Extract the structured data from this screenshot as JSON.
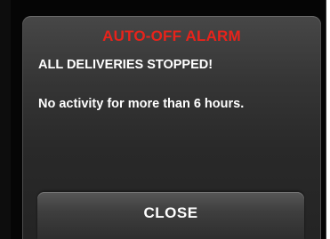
{
  "alarm": {
    "title": "AUTO-OFF ALARM",
    "line1": "ALL DELIVERIES STOPPED!",
    "line2": "No activity for more than 6 hours.",
    "title_color": "#e8231b"
  },
  "actions": {
    "close_label": "CLOSE"
  }
}
